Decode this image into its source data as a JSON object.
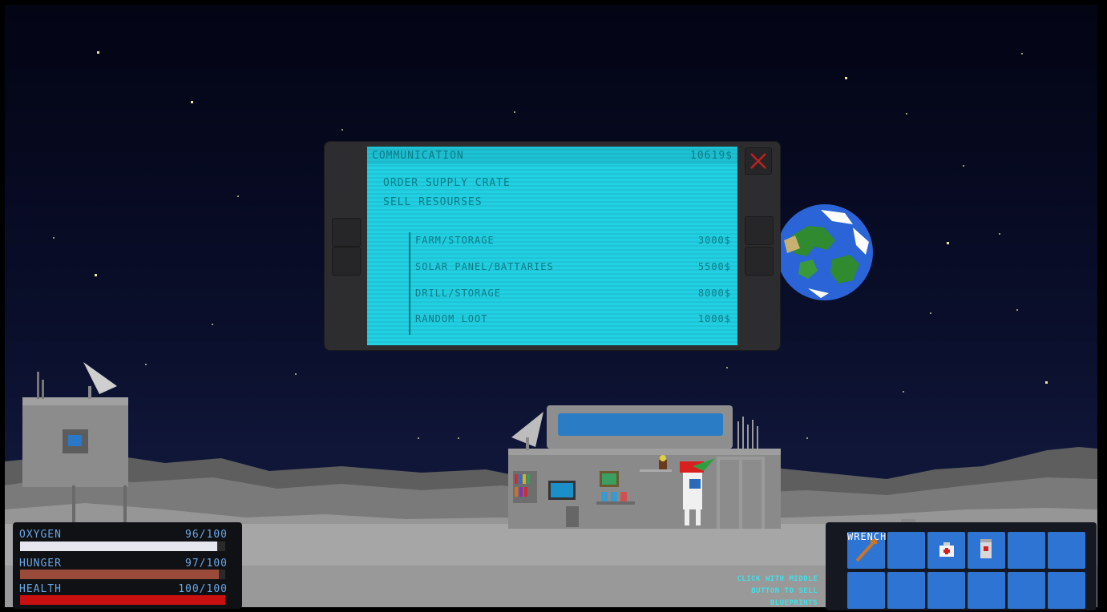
{
  "communication": {
    "title": "COMMUNICATION",
    "money": "10619$",
    "options": [
      "ORDER SUPPLY CRATE",
      "SELL RESOURSES"
    ],
    "blueprints": [
      {
        "name": "FARM/STORAGE",
        "price": "3000$"
      },
      {
        "name": "SOLAR PANEL/BATTARIES",
        "price": "5500$"
      },
      {
        "name": "DRILL/STORAGE",
        "price": "8000$"
      },
      {
        "name": "RANDOM LOOT",
        "price": "1000$"
      }
    ]
  },
  "status": {
    "oxygen": {
      "label": "OXYGEN",
      "value": "96/100",
      "fraction": 0.96,
      "color": "#e6e6ee"
    },
    "hunger": {
      "label": "HUNGER",
      "value": "97/100",
      "fraction": 0.97,
      "color": "#9a4a38"
    },
    "health": {
      "label": "HEALTH",
      "value": "100/100",
      "fraction": 1.0,
      "color": "#c91010"
    }
  },
  "hint": {
    "line1": "CLICK WITH MIDDLE",
    "line2": "BUTTON TO SELL",
    "line3": "BLUEPRINTS"
  },
  "inventory": {
    "selected_label": "WRENCH",
    "slots": [
      "wrench-icon",
      "",
      "medkit-icon",
      "food-jar-icon",
      "",
      "",
      "",
      "",
      "",
      "",
      "",
      ""
    ]
  }
}
